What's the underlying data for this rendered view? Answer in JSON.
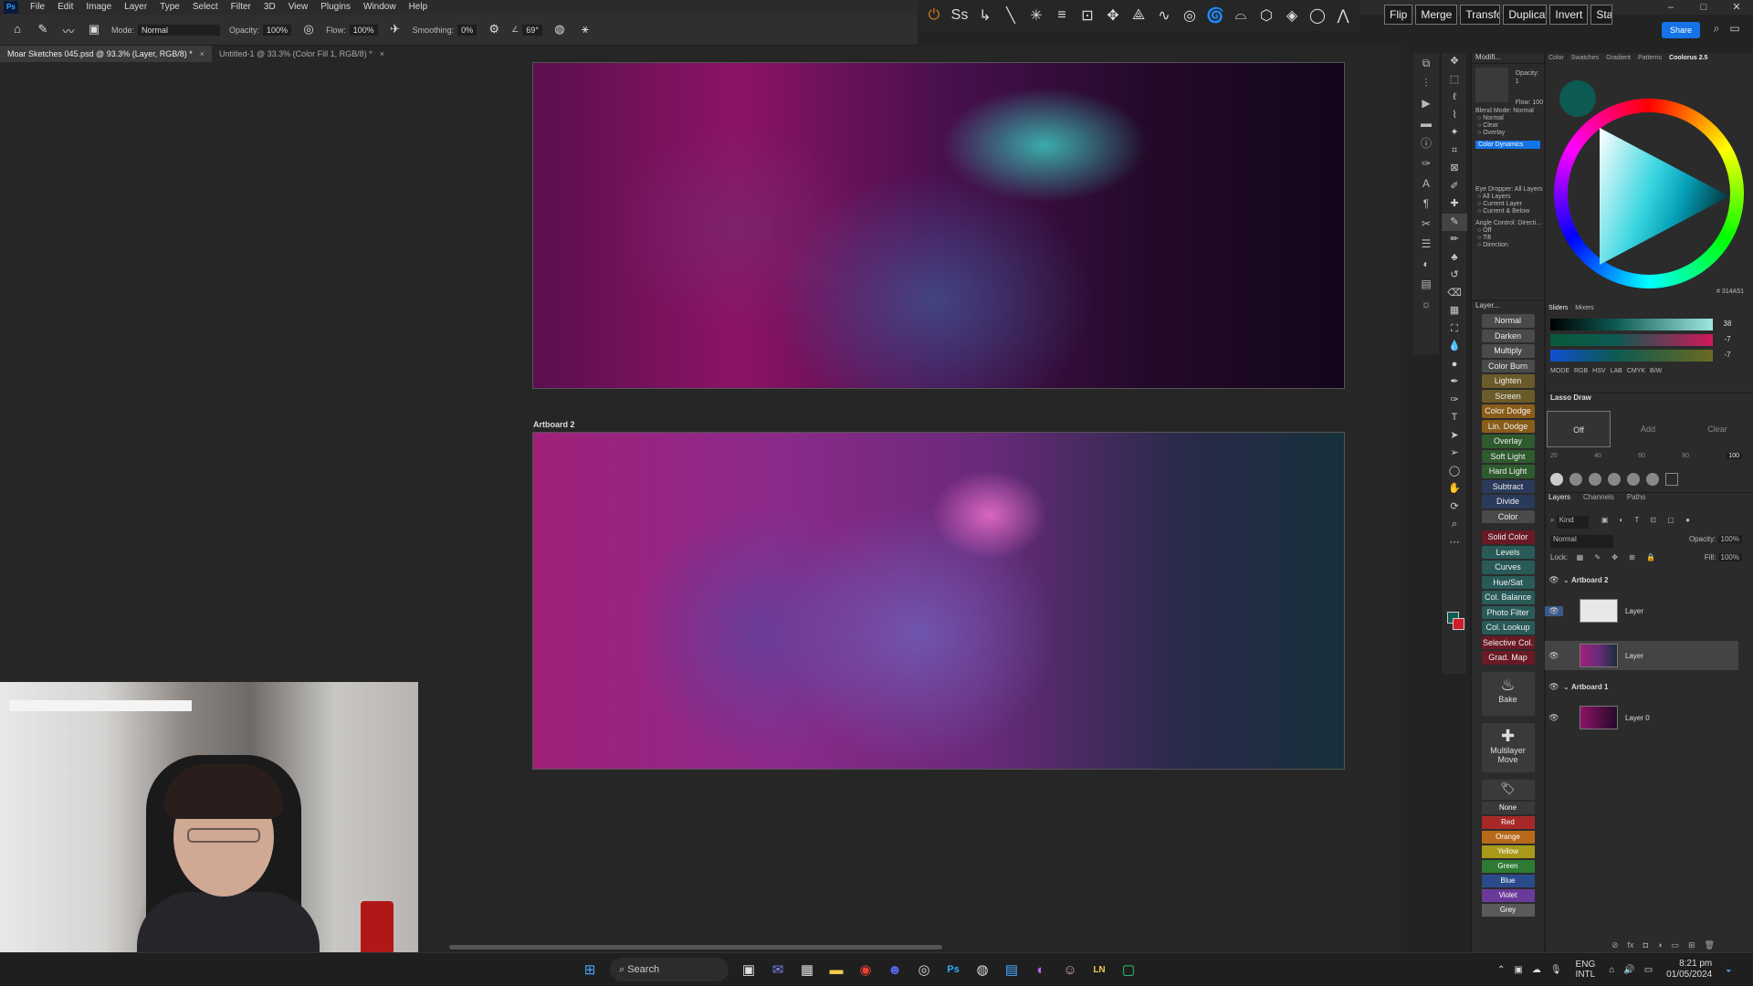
{
  "menubar": {
    "logo": "Ps",
    "items": [
      "File",
      "Edit",
      "Image",
      "Layer",
      "Type",
      "Select",
      "Filter",
      "3D",
      "View",
      "Plugins",
      "Window",
      "Help"
    ],
    "window_controls": [
      "–",
      "□",
      "✕"
    ]
  },
  "quick_actions": {
    "buttons": [
      "Flip",
      "Merge",
      "Transform",
      "Duplicate",
      "Invert",
      "Stamp"
    ]
  },
  "options_bar": {
    "mode_label": "Mode:",
    "mode_value": "Normal",
    "opacity_label": "Opacity:",
    "opacity_value": "100%",
    "flow_label": "Flow:",
    "flow_value": "100%",
    "smoothing_label": "Smoothing:",
    "smoothing_value": "0%",
    "angle_value": "69°",
    "share_label": "Share"
  },
  "tabs": [
    {
      "title": "Moar Sketches 045.psd @ 93.3% (Layer, RGB/8) *",
      "active": true
    },
    {
      "title": "Untitled-1 @ 33.3% (Color Fill 1, RGB/8) *",
      "active": false
    }
  ],
  "canvas": {
    "artboard2_label": "Artboard 2"
  },
  "modifier_panel": {
    "title": "Modifi...",
    "opacity_label": "Opacity: 1",
    "flow_label": "Flow: 100",
    "blend_mode_label": "Blend Mode: Normal",
    "blend_options": [
      "Normal",
      "Clear",
      "Overlay"
    ],
    "color_dynamics": "Color Dynamics",
    "eyedropper_label": "Eye Dropper: All Layers",
    "eyedropper_options": [
      "All Layers",
      "Current Layer",
      "Current & Below"
    ],
    "angle_label": "Angle Control: Directi...",
    "angle_options": [
      "Off",
      "Tilt",
      "Direction"
    ]
  },
  "blend_panel": {
    "title": "Layer...",
    "modes": [
      {
        "label": "Normal",
        "style": "gray"
      },
      {
        "label": "Darken",
        "style": "gray"
      },
      {
        "label": "Multiply",
        "style": "gray"
      },
      {
        "label": "Color Burn",
        "style": "gray"
      },
      {
        "label": "Lighten",
        "style": "brown"
      },
      {
        "label": "Screen",
        "style": "brown"
      },
      {
        "label": "Color Dodge",
        "style": "orange"
      },
      {
        "label": "Lin. Dodge",
        "style": "orange"
      },
      {
        "label": "Overlay",
        "style": "green"
      },
      {
        "label": "Soft Light",
        "style": "green"
      },
      {
        "label": "Hard Light",
        "style": "green"
      },
      {
        "label": "Subtract",
        "style": "blue"
      },
      {
        "label": "Divide",
        "style": "blue"
      },
      {
        "label": "Color",
        "style": "gray"
      }
    ],
    "adjustments": [
      {
        "label": "Solid Color",
        "style": "darkred"
      },
      {
        "label": "Levels",
        "style": "teal"
      },
      {
        "label": "Curves",
        "style": "teal"
      },
      {
        "label": "Hue/Sat",
        "style": "teal"
      },
      {
        "label": "Col. Balance",
        "style": "teal"
      },
      {
        "label": "Photo Filter",
        "style": "teal"
      },
      {
        "label": "Col. Lookup",
        "style": "teal"
      },
      {
        "label": "Selective Col.",
        "style": "darkred"
      },
      {
        "label": "Grad. Map",
        "style": "darkred"
      }
    ],
    "bake_label": "Bake",
    "multilayer_label": "Multilayer Move",
    "color_labels": [
      {
        "label": "None",
        "color": "#3a3a3a"
      },
      {
        "label": "Red",
        "color": "#a82828"
      },
      {
        "label": "Orange",
        "color": "#b86a1a"
      },
      {
        "label": "Yellow",
        "color": "#a89a18"
      },
      {
        "label": "Green",
        "color": "#2e7a34"
      },
      {
        "label": "Blue",
        "color": "#2a4a8a"
      },
      {
        "label": "Violet",
        "color": "#6a3a9a"
      },
      {
        "label": "Grey",
        "color": "#5a5a5a"
      }
    ]
  },
  "color_panel": {
    "tabs": [
      "Color",
      "Swatches",
      "Gradient",
      "Patterns",
      "Coolorus 2.5"
    ],
    "active_tab": "Coolorus 2.5",
    "hex": "314A51",
    "swatch_color": "#0d5a52"
  },
  "sliders_panel": {
    "tabs": [
      "Sliders",
      "Mixers"
    ],
    "values": [
      "38",
      "-7",
      "-7"
    ],
    "modes": [
      "MODE",
      "RGB",
      "HSV",
      "LAB",
      "CMYK",
      "B/W"
    ]
  },
  "lasso_panel": {
    "title": "Lasso Draw",
    "buttons": [
      "Off",
      "Add",
      "Clear"
    ],
    "scale": [
      "20",
      "40",
      "60",
      "80",
      "100"
    ]
  },
  "layers_panel": {
    "tabs": [
      "Layers",
      "Channels",
      "Paths"
    ],
    "filter_label": "Kind",
    "blend_value": "Normal",
    "opacity_label": "Opacity:",
    "opacity_value": "100%",
    "lock_label": "Lock:",
    "fill_label": "Fill:",
    "fill_value": "100%",
    "groups": [
      {
        "name": "Artboard 2",
        "layers": [
          {
            "name": "Layer",
            "thumb": "white",
            "selected": false
          },
          {
            "name": "Layer",
            "thumb": "art",
            "selected": true
          }
        ]
      },
      {
        "name": "Artboard 1",
        "layers": [
          {
            "name": "Layer 0",
            "thumb": "art",
            "selected": false
          }
        ]
      }
    ]
  },
  "taskbar": {
    "search_placeholder": "Search",
    "language_line1": "ENG",
    "language_line2": "INTL",
    "time": "8:21 pm",
    "date": "01/05/2024"
  }
}
